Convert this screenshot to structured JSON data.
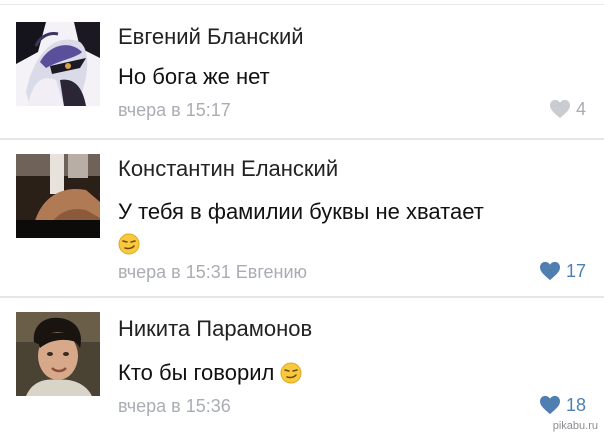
{
  "comments": [
    {
      "author": "Евгений Бланский",
      "text": "Но бога же нет",
      "meta": "вчера в 15:17",
      "likes": "4",
      "liked": false
    },
    {
      "author": "Константин Еланский",
      "text": "У тебя в фамилии буквы не хватает",
      "meta": "вчера в 15:31 Евгению",
      "likes": "17",
      "liked": true
    },
    {
      "author": "Никита Парамонов",
      "text": "Кто бы говорил",
      "meta": "вчера в 15:36",
      "likes": "18",
      "liked": true
    }
  ],
  "colors": {
    "like_active": "#4f7fb1",
    "like_inactive": "#c9ccd1",
    "meta_text": "#a9adb3",
    "divider": "#e4e6ea"
  },
  "icons": {
    "heart": "heart-icon",
    "emoji": "smirk-emoji-icon"
  },
  "watermark": "pikabu.ru"
}
